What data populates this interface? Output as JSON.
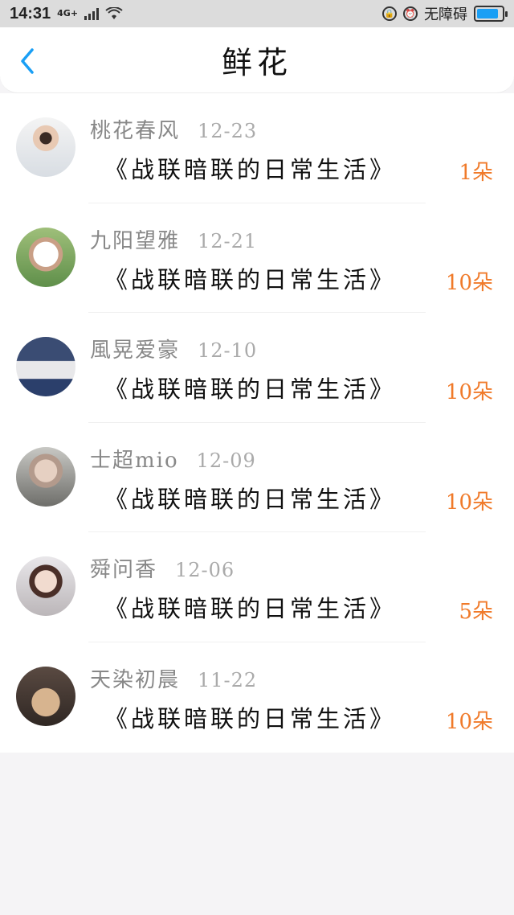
{
  "status_bar": {
    "time": "14:31",
    "network": "4G+",
    "accessibility_text": "无障碍",
    "battery_level": 0.85
  },
  "header": {
    "title": "鲜花"
  },
  "items": [
    {
      "name": "桃花春风",
      "date": "12-23",
      "book": "《战联暗联的日常生活》",
      "count": "1朵"
    },
    {
      "name": "九阳望雅",
      "date": "12-21",
      "book": "《战联暗联的日常生活》",
      "count": "10朵"
    },
    {
      "name": "風晃爱豪",
      "date": "12-10",
      "book": "《战联暗联的日常生活》",
      "count": "10朵"
    },
    {
      "name": "士超mio",
      "date": "12-09",
      "book": "《战联暗联的日常生活》",
      "count": "10朵"
    },
    {
      "name": "舜问香",
      "date": "12-06",
      "book": "《战联暗联的日常生活》",
      "count": "5朵"
    },
    {
      "name": "天染初晨",
      "date": "11-22",
      "book": "《战联暗联的日常生活》",
      "count": "10朵"
    }
  ],
  "colors": {
    "accent": "#1a9ff5",
    "count": "#f07a2a",
    "name": "#888888",
    "date": "#aaaaaa"
  }
}
